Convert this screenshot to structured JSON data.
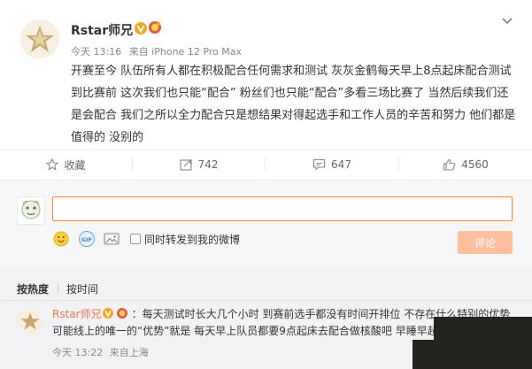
{
  "post": {
    "nickname": "Rstar师兄",
    "time": "今天 13:16",
    "source": "来自 iPhone 12 Pro Max",
    "text": "开赛至今 队伍所有人都在积极配合任何需求和测试 灰灰金鹤每天早上8点起床配合测试到比赛前 这次我们也只能“配合” 粉丝们也只能“配合”多看三场比赛了 当然后续我们还是会配合 我们之所以全力配合只是想结果对得起选手和工作人员的辛苦和努力 他们都是值得的 没别的"
  },
  "actions": {
    "favorite": "收藏",
    "forward": "742",
    "comment": "647",
    "like": "4560"
  },
  "composer": {
    "forward_label": "同时转发到我的微博",
    "submit": "评论"
  },
  "sort_tabs": {
    "hot": "按热度",
    "time": "按时间"
  },
  "comment": {
    "nickname": "Rstar师兄",
    "text_line1": "：每天测试时长大几个小时 到赛前选手都没有时间开排位 不存在什么特别的优势",
    "text_line2": "可能线上的唯一的“优势”就是 每天早上队员都要9点起床去配合做核酸吧 早睡早起对身体好",
    "time": "今天 13:22",
    "source": "来自上海"
  },
  "colors": {
    "accent": "#ff8140",
    "link": "#eb7350",
    "submit_disabled": "#ffc09f",
    "vip_gold": "#f5a623"
  },
  "icons": {
    "more": "chevron-down-icon",
    "favorite": "star-icon",
    "forward": "forward-icon",
    "comment": "comment-icon",
    "like": "thumbs-up-icon",
    "emoji": "emoji-icon",
    "gif": "gif-icon",
    "image": "image-icon"
  }
}
